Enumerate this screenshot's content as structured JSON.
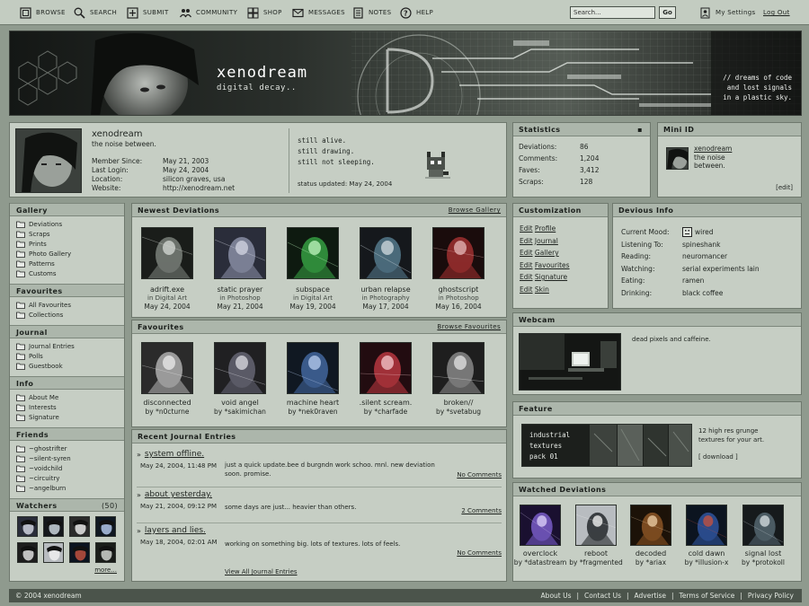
{
  "nav": {
    "items": [
      {
        "label": "BROWSE",
        "icon": "browse-icon"
      },
      {
        "label": "SEARCH",
        "icon": "search-icon"
      },
      {
        "label": "SUBMIT",
        "icon": "submit-icon"
      },
      {
        "label": "COMMUNITY",
        "icon": "community-icon"
      },
      {
        "label": "SHOP",
        "icon": "shop-icon"
      },
      {
        "label": "MESSAGES",
        "icon": "messages-icon"
      },
      {
        "label": "NOTES",
        "icon": "notes-icon"
      },
      {
        "label": "HELP",
        "icon": "help-icon"
      }
    ],
    "search_value": "Search...",
    "go_label": "Go",
    "settings_label": "My Settings",
    "logout_label": "Log Out"
  },
  "banner": {
    "title": "xenodream",
    "subtitle": "digital decay..",
    "quote": "// dreams of code\nand lost signals\nin a plastic sky."
  },
  "profile": {
    "username": "xenodream",
    "tagline": "the noise between.",
    "fields": [
      {
        "label": "Member Since:",
        "value": "May 21, 2003"
      },
      {
        "label": "Last Login:",
        "value": "May 24, 2004"
      },
      {
        "label": "Location:",
        "value": "silicon graves, usa"
      },
      {
        "label": "Website:",
        "value": "http://xenodream.net"
      }
    ],
    "status_lines": [
      "still alive.",
      "still drawing.",
      "still not sleeping."
    ],
    "status_updated": "status updated: May 24, 2004"
  },
  "stats": {
    "title": "Statistics",
    "rows": [
      {
        "label": "Deviations:",
        "value": "86"
      },
      {
        "label": "Comments:",
        "value": "1,204"
      },
      {
        "label": "Faves:",
        "value": "3,412"
      },
      {
        "label": "Scraps:",
        "value": "128"
      }
    ]
  },
  "mini_id": {
    "title": "Mini ID",
    "name": "xenodream",
    "tagline_1": "the noise",
    "tagline_2": "between.",
    "edit": "[edit]"
  },
  "sidebar": {
    "sections": [
      {
        "title": "Gallery",
        "items": [
          "Deviations",
          "Scraps",
          "Prints",
          "Photo Gallery",
          "Patterns",
          "Customs"
        ]
      },
      {
        "title": "Favourites",
        "items": [
          "All Favourites",
          "Collections"
        ]
      },
      {
        "title": "Journal",
        "items": [
          "Journal Entries",
          "Polls",
          "Guestbook"
        ]
      },
      {
        "title": "Info",
        "items": [
          "About Me",
          "Interests",
          "Signature"
        ]
      },
      {
        "title": "Friends",
        "items": [
          "~ghostrifter",
          "~silent-syren",
          "~voidchild",
          "~circuitry",
          "~angelburn"
        ]
      }
    ],
    "watchers_title": "Watchers",
    "watchers_count": "(50)",
    "more": "more..."
  },
  "newest": {
    "title": "Newest Deviations",
    "link": "Browse Gallery",
    "items": [
      {
        "title": "adrift.exe",
        "cat": "in Digital Art",
        "date": "May 24, 2004"
      },
      {
        "title": "static prayer",
        "cat": "in Photoshop",
        "date": "May 21, 2004"
      },
      {
        "title": "subspace",
        "cat": "in Digital Art",
        "date": "May 19, 2004"
      },
      {
        "title": "urban relapse",
        "cat": "in Photography",
        "date": "May 17, 2004"
      },
      {
        "title": "ghostscript",
        "cat": "in Photoshop",
        "date": "May 16, 2004"
      }
    ]
  },
  "favourites": {
    "title": "Favourites",
    "link": "Browse Favourites",
    "items": [
      {
        "title": "disconnected",
        "by": "by *n0cturne"
      },
      {
        "title": "void angel",
        "by": "by *sakimichan"
      },
      {
        "title": "machine heart",
        "by": "by *nek0raven"
      },
      {
        "title": ".silent scream.",
        "by": "by *charfade"
      },
      {
        "title": "broken//",
        "by": "by *svetabug"
      }
    ]
  },
  "journal": {
    "title": "Recent Journal Entries",
    "entries": [
      {
        "title": "system offline.",
        "date": "May 24, 2004, 11:48 PM",
        "text_1": "just a quick update.bee d burgndn work schoo. mnl. new deviation",
        "text_2": "soon. promise.",
        "comments": "No Comments"
      },
      {
        "title": "about yesterday.",
        "date": "May 21, 2004, 09:12 PM",
        "text_1": "some days are just... heavier than others.",
        "text_2": "",
        "comments": "2 Comments"
      },
      {
        "title": "layers and lies.",
        "date": "May 18, 2004, 02:01 AM",
        "text_1": "working on something big. lots of textures. lots of feels.",
        "text_2": "",
        "comments": "No Comments"
      }
    ],
    "view_all": "View All Journal Entries"
  },
  "customization": {
    "title": "Customization",
    "items": [
      {
        "edit": "Edit",
        "label": "Profile"
      },
      {
        "edit": "Edit",
        "label": "Journal"
      },
      {
        "edit": "Edit",
        "label": "Gallery"
      },
      {
        "edit": "Edit",
        "label": "Favourites"
      },
      {
        "edit": "Edit",
        "label": "Signature"
      },
      {
        "edit": "Edit",
        "label": "Skin"
      }
    ]
  },
  "devious": {
    "title": "Devious Info",
    "rows": [
      {
        "label": "Current Mood:",
        "value": "wired"
      },
      {
        "label": "Listening To:",
        "value": "spineshank"
      },
      {
        "label": "Reading:",
        "value": "neuromancer"
      },
      {
        "label": "Watching:",
        "value": "serial experiments lain"
      },
      {
        "label": "Eating:",
        "value": "ramen"
      },
      {
        "label": "Drinking:",
        "value": "black coffee"
      }
    ]
  },
  "webcam": {
    "title": "Webcam",
    "caption": "dead pixels and caffeine."
  },
  "feature": {
    "title": "Feature",
    "image_text_1": "industrial",
    "image_text_2": "textures",
    "image_text_3": "pack 01",
    "desc_1": "12 high res grunge",
    "desc_2": "textures for your art.",
    "download": "[ download ]"
  },
  "watched": {
    "title": "Watched Deviations",
    "items": [
      {
        "title": "overclock",
        "by": "by *datastream"
      },
      {
        "title": "reboot",
        "by": "by *fragmented"
      },
      {
        "title": "decoded",
        "by": "by *ariax"
      },
      {
        "title": "cold dawn",
        "by": "by *illusion-x"
      },
      {
        "title": "signal lost",
        "by": "by *protokoll"
      }
    ]
  },
  "footer": {
    "copyright": "© 2004 xenodream",
    "links": [
      "About Us",
      "Contact Us",
      "Advertise",
      "Terms of Service",
      "Privacy Policy"
    ]
  }
}
